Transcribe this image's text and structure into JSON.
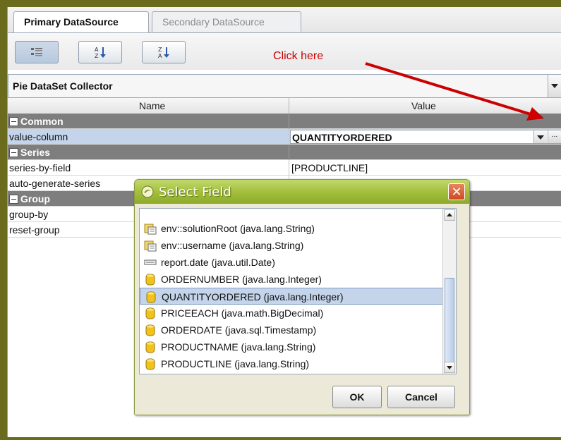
{
  "tabs": [
    {
      "label": "Primary DataSource",
      "active": true
    },
    {
      "label": "Secondary DataSource",
      "active": false
    }
  ],
  "toolbar": {
    "buttons": [
      {
        "icon": "categorized-view-icon",
        "pressed": true
      },
      {
        "icon": "sort-ascending-icon",
        "pressed": false
      },
      {
        "icon": "sort-descending-icon",
        "pressed": false
      }
    ]
  },
  "annotation": {
    "text": "Click here",
    "color": "#cc0000"
  },
  "collector": {
    "selected": "Pie DataSet Collector"
  },
  "grid": {
    "columns": {
      "name": "Name",
      "value": "Value"
    },
    "rows": [
      {
        "type": "group",
        "name": "Common",
        "value": ""
      },
      {
        "type": "prop",
        "name": "value-column",
        "value": "QUANTITYORDERED",
        "selected": true
      },
      {
        "type": "group",
        "name": "Series",
        "value": ""
      },
      {
        "type": "prop",
        "name": "series-by-field",
        "value": "[PRODUCTLINE]"
      },
      {
        "type": "prop",
        "name": "auto-generate-series",
        "value": ""
      },
      {
        "type": "group",
        "name": "Group",
        "value": ""
      },
      {
        "type": "prop",
        "name": "group-by",
        "value": ""
      },
      {
        "type": "prop",
        "name": "reset-group",
        "value": ""
      }
    ]
  },
  "dialog": {
    "title": "Select Field",
    "items": [
      {
        "label": "env::solutionRoot (java.lang.String)",
        "icon": "env-icon"
      },
      {
        "label": "env::username (java.lang.String)",
        "icon": "env-icon"
      },
      {
        "label": "report.date (java.util.Date)",
        "icon": "function-icon"
      },
      {
        "label": "ORDERNUMBER (java.lang.Integer)",
        "icon": "database-field-icon"
      },
      {
        "label": "QUANTITYORDERED (java.lang.Integer)",
        "icon": "database-field-icon",
        "selected": true
      },
      {
        "label": "PRICEEACH (java.math.BigDecimal)",
        "icon": "database-field-icon"
      },
      {
        "label": "ORDERDATE (java.sql.Timestamp)",
        "icon": "database-field-icon"
      },
      {
        "label": "PRODUCTNAME (java.lang.String)",
        "icon": "database-field-icon"
      },
      {
        "label": "PRODUCTLINE (java.lang.String)",
        "icon": "database-field-icon"
      }
    ],
    "ok_label": "OK",
    "cancel_label": "Cancel"
  }
}
